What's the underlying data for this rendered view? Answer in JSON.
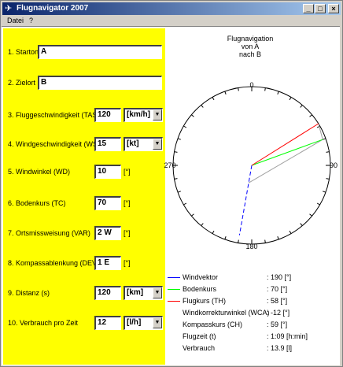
{
  "window": {
    "title": "Flugnavigator 2007",
    "minimize": "_",
    "maximize": "□",
    "close": "×"
  },
  "menu": [
    "Datei",
    "?"
  ],
  "form": [
    {
      "label": "1. Startort",
      "value": "A"
    },
    {
      "label": "2. Zielort",
      "value": "B"
    },
    {
      "label": "3. Fluggeschwindigkeit (TAS)",
      "value": "120",
      "unit": "[km/h]",
      "unit_is_combo": true
    },
    {
      "label": "4. Windgeschwindigkeit (WS)",
      "value": "15",
      "unit": "[kt]",
      "unit_is_combo": true
    },
    {
      "label": "5. Windwinkel (WD)",
      "value": "10",
      "unit": "[°]"
    },
    {
      "label": "6. Bodenkurs (TC)",
      "value": "70",
      "unit": "[°]"
    },
    {
      "label": "7. Ortsmissweisung (VAR)",
      "value": "2 W",
      "unit": "[°]"
    },
    {
      "label": "8. Kompassablenkung (DEV)",
      "value": "1 E",
      "unit": "[°]"
    },
    {
      "label": "9. Distanz (s)",
      "value": "120",
      "unit": "[km]",
      "unit_is_combo": true
    },
    {
      "label": "10. Verbrauch pro Zeit",
      "value": "12",
      "unit": "[l/h]",
      "unit_is_combo": true
    }
  ],
  "graph": {
    "title_lines": [
      "Flugnavigation",
      "von A",
      "nach B"
    ],
    "compass_labels": [
      "0",
      "90",
      "180",
      "270"
    ],
    "windvektor_deg": 190,
    "bodenkurs_deg": 70,
    "flugkurs_deg": 58,
    "colors": {
      "wind": "#0000ff",
      "boden": "#00ff00",
      "flug": "#ff0000",
      "gray": "#a0a0a0"
    }
  },
  "results": [
    {
      "name": "Windvektor",
      "value": ": 190 [°]",
      "line_color": "#0000ff"
    },
    {
      "name": "Bodenkurs",
      "value": ": 70 [°]",
      "line_color": "#00ff00"
    },
    {
      "name": "Flugkurs (TH)",
      "value": ": 58 [°]",
      "line_color": "#ff0000"
    },
    {
      "name": "Windkorrekturwinkel (WCA)",
      "value": ": -12 [°]"
    },
    {
      "name": "Kompasskurs (CH)",
      "value": ": 59 [°]"
    },
    {
      "name": "Flugzeit (t)",
      "value": ": 1:09 [h:min]"
    },
    {
      "name": "Verbrauch",
      "value": ": 13.9 [l]"
    }
  ]
}
